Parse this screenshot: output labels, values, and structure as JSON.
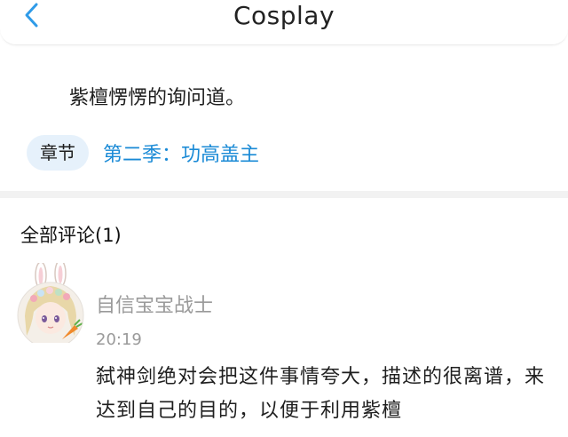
{
  "header": {
    "title": "Cosplay",
    "back_icon": "chevron-left-icon",
    "accent_color": "#2f9be8"
  },
  "content": {
    "text": "紫檀愣愣的询问道。"
  },
  "chapter": {
    "pill_label": "章节",
    "link_text": "第二季：功高盖主"
  },
  "comments": {
    "title": "全部评论(1)",
    "items": [
      {
        "username": "自信宝宝战士",
        "time": "20:19",
        "body": "弑神剑绝对会把这件事情夸大，描述的很离谱，来达到自己的目的，以便于利用紫檀"
      }
    ]
  }
}
